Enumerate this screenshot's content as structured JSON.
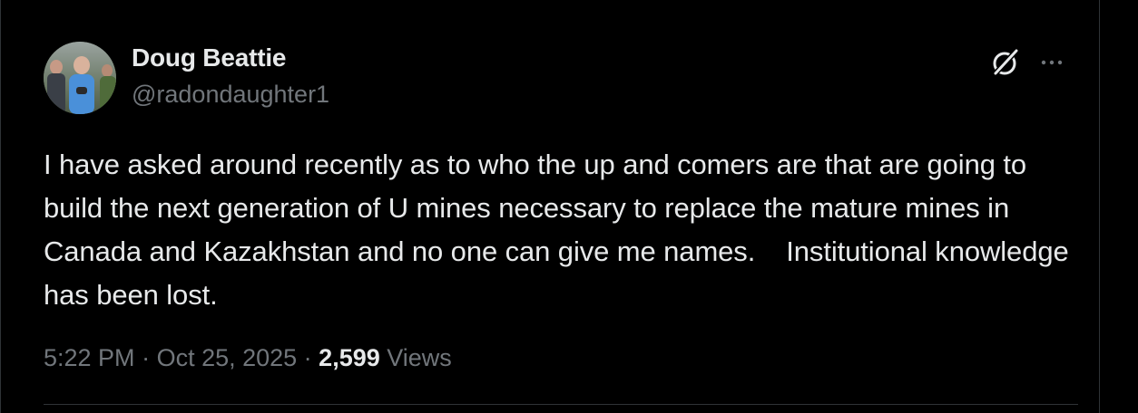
{
  "tweet": {
    "author": {
      "name": "Doug Beattie",
      "handle": "@radondaughter1"
    },
    "text": "I have asked around recently as to who the up and comers are that are going to build the next generation of U mines necessary to replace the mature mines in Canada and Kazakhstan and no one can give me names.    Institutional knowledge has been lost.",
    "time": "5:22 PM",
    "separator": " · ",
    "date": "Oct 25, 2025",
    "views_count": "2,599",
    "views_label": " Views"
  },
  "icons": {
    "avatar": "profile-photo",
    "grok": "grok-icon",
    "more": "more-icon"
  },
  "colors": {
    "background": "#000000",
    "text_primary": "#e7e9ea",
    "text_secondary": "#71767b",
    "border": "#2f3336"
  }
}
